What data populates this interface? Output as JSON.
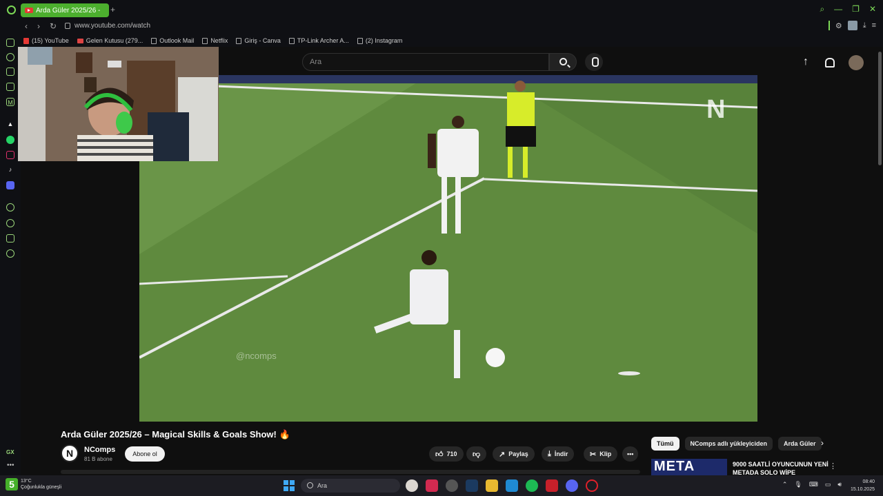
{
  "browser": {
    "tab_title": "Arda Güler 2025/26 -",
    "url": "www.youtube.com/watch",
    "bookmarks": [
      {
        "label": "(15) YouTube"
      },
      {
        "label": "Gelen Kutusu (279..."
      },
      {
        "label": "Outlook Mail"
      },
      {
        "label": "Netflix"
      },
      {
        "label": "Giriş - Canva"
      },
      {
        "label": "TP-Link Archer A..."
      },
      {
        "label": "(2) Instagram"
      }
    ],
    "sidebar_bottom": "GX"
  },
  "youtube": {
    "search_placeholder": "Ara",
    "video_title": "Arda Güler 2025/26 – Magical Skills & Goals Show! 🔥",
    "watermark": "@ncomps",
    "channel": {
      "name": "NComps",
      "subscribers": "81 B abone",
      "subscribe_label": "Abone ol"
    },
    "actions": {
      "likes": "710",
      "share": "Paylaş",
      "download": "İndir",
      "clip": "Klip",
      "more": "•••"
    },
    "chips": [
      "Tümü",
      "NComps adlı yükleyiciden",
      "Arda Güler"
    ],
    "suggestion": {
      "thumb_text": "META",
      "title": "9000 SAATLİ OYUNCUNUN YENİ METADA SOLO WİPE"
    }
  },
  "taskbar": {
    "weather_temp": "13°C",
    "weather_text": "Çoğunlukla güneşli",
    "badge": "5",
    "search_placeholder": "Ara",
    "time": "08:40",
    "date": "15.10.2025"
  },
  "colors": {
    "accent": "#7dd957",
    "tab": "#4caf2e",
    "pitch": "#5f8a3e"
  }
}
